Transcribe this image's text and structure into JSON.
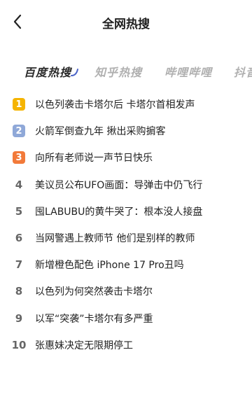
{
  "header": {
    "title": "全网热搜"
  },
  "tabs": [
    {
      "label": "百度热搜",
      "active": true
    },
    {
      "label": "知乎热搜",
      "active": false
    },
    {
      "label": "哔哩哔哩",
      "active": false
    },
    {
      "label": "抖音",
      "active": false
    }
  ],
  "colors": {
    "rank_1": "#f5b400",
    "rank_2": "#8fa8d8",
    "rank_3": "#f27a3a",
    "tab_indicator": "#4a63c7"
  },
  "hot_list": [
    {
      "rank": "1",
      "text": "以色列袭击卡塔尔后 卡塔尔首相发声"
    },
    {
      "rank": "2",
      "text": "火箭军倒查九年 揪出采购掮客"
    },
    {
      "rank": "3",
      "text": "向所有老师说一声节日快乐"
    },
    {
      "rank": "4",
      "text": "美议员公布UFO画面：导弹击中仍飞行"
    },
    {
      "rank": "5",
      "text": "囤LABUBU的黄牛哭了：根本没人接盘"
    },
    {
      "rank": "6",
      "text": "当网警遇上教师节 他们是别样的教师"
    },
    {
      "rank": "7",
      "text": "新增橙色配色 iPhone 17 Pro丑吗"
    },
    {
      "rank": "8",
      "text": "以色列为何突然袭击卡塔尔"
    },
    {
      "rank": "9",
      "text": "以军“突袭”卡塔尔有多严重"
    },
    {
      "rank": "10",
      "text": "张惠妹决定无限期停工"
    }
  ]
}
